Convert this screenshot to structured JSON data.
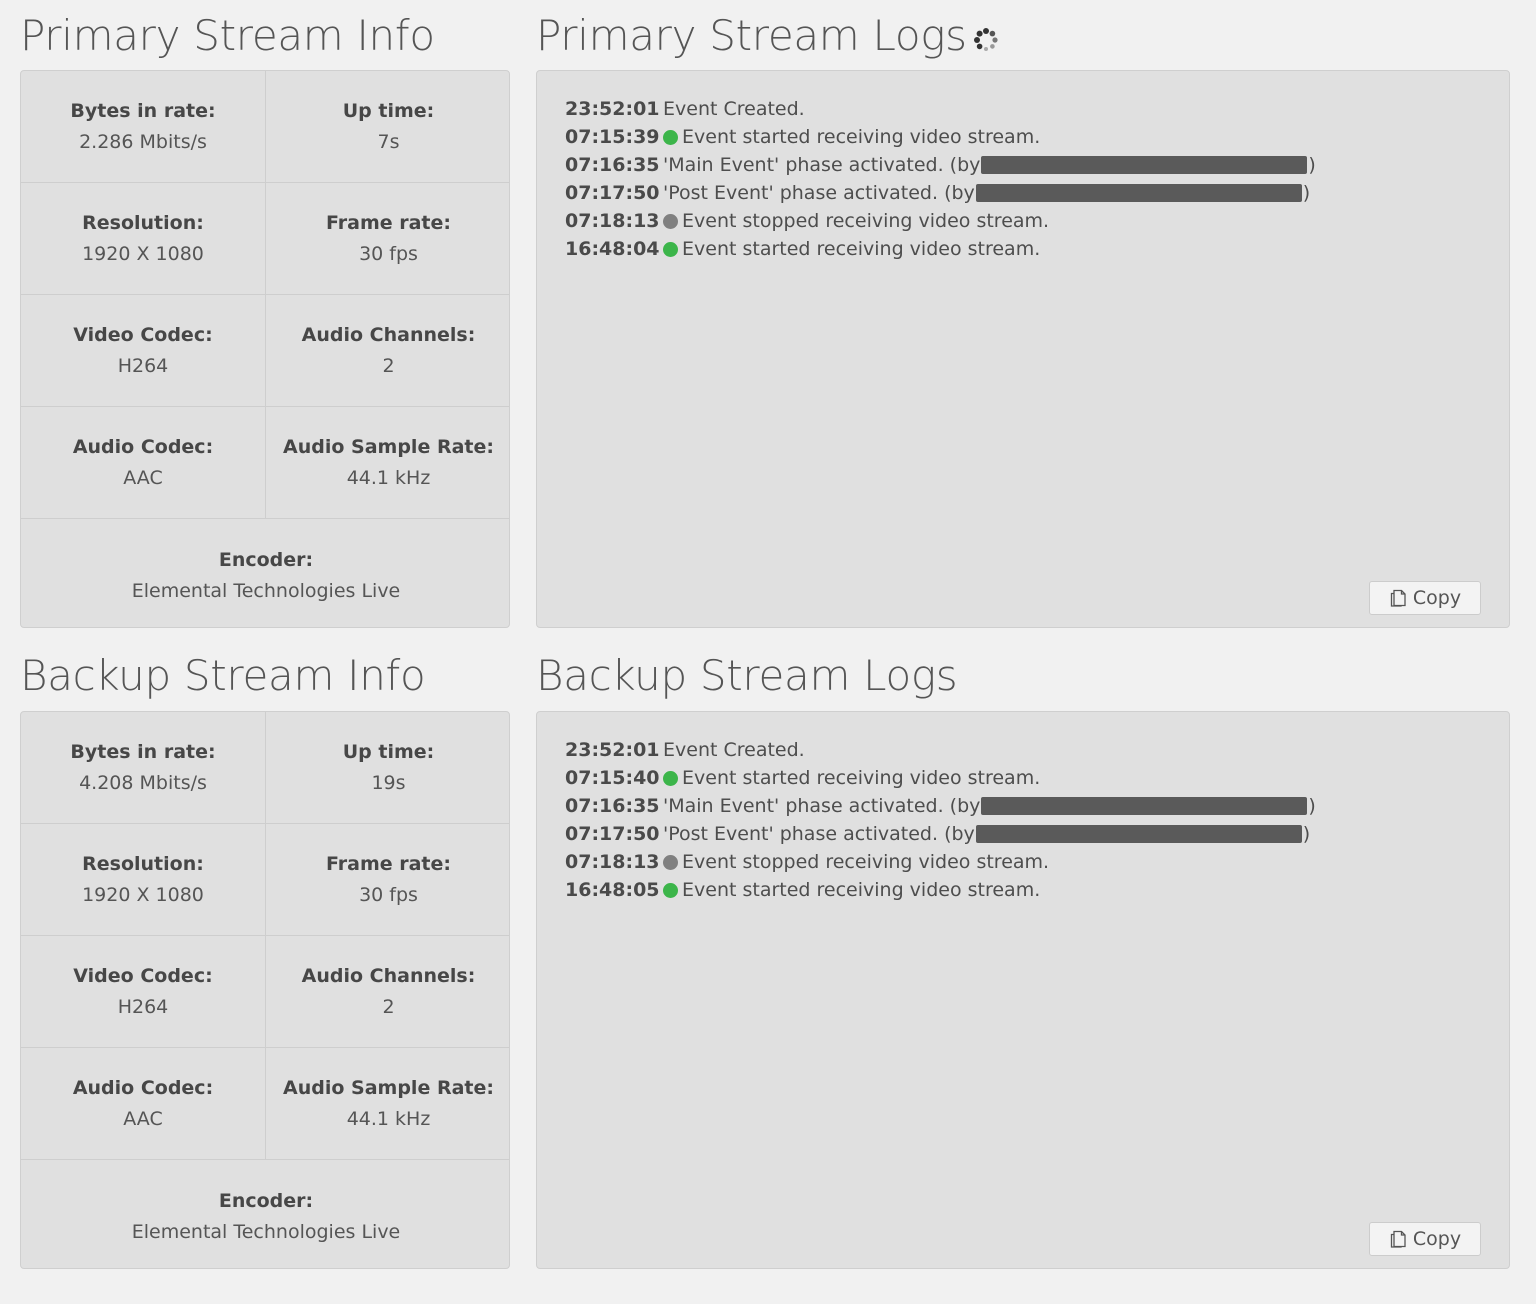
{
  "primary": {
    "info_title": "Primary Stream Info",
    "logs_title": "Primary Stream Logs",
    "info": {
      "bytes_in_rate": {
        "label": "Bytes in rate:",
        "value": "2.286 Mbits/s"
      },
      "up_time": {
        "label": "Up time:",
        "value": "7s"
      },
      "resolution": {
        "label": "Resolution:",
        "value": "1920 X 1080"
      },
      "frame_rate": {
        "label": "Frame rate:",
        "value": "30 fps"
      },
      "video_codec": {
        "label": "Video Codec:",
        "value": "H264"
      },
      "audio_channels": {
        "label": "Audio Channels:",
        "value": "2"
      },
      "audio_codec": {
        "label": "Audio Codec:",
        "value": "AAC"
      },
      "audio_sample_rate": {
        "label": "Audio Sample Rate:",
        "value": "44.1 kHz"
      },
      "encoder": {
        "label": "Encoder:",
        "value": "Elemental Technologies Live"
      }
    },
    "logs": [
      {
        "time": "23:52:01",
        "status": "none",
        "message": "Event Created."
      },
      {
        "time": "07:15:39",
        "status": "green",
        "message": "Event started receiving video stream."
      },
      {
        "time": "07:16:35",
        "status": "none",
        "message": "'Main Event' phase activated. (by",
        "redacted": true
      },
      {
        "time": "07:17:50",
        "status": "none",
        "message": "'Post Event' phase activated. (by",
        "redacted": true
      },
      {
        "time": "07:18:13",
        "status": "gray",
        "message": "Event stopped receiving video stream."
      },
      {
        "time": "16:48:04",
        "status": "green",
        "message": "Event started receiving video stream."
      }
    ],
    "copy_label": "Copy"
  },
  "backup": {
    "info_title": "Backup Stream Info",
    "logs_title": "Backup Stream Logs",
    "info": {
      "bytes_in_rate": {
        "label": "Bytes in rate:",
        "value": "4.208 Mbits/s"
      },
      "up_time": {
        "label": "Up time:",
        "value": "19s"
      },
      "resolution": {
        "label": "Resolution:",
        "value": "1920 X 1080"
      },
      "frame_rate": {
        "label": "Frame rate:",
        "value": "30 fps"
      },
      "video_codec": {
        "label": "Video Codec:",
        "value": "H264"
      },
      "audio_channels": {
        "label": "Audio Channels:",
        "value": "2"
      },
      "audio_codec": {
        "label": "Audio Codec:",
        "value": "AAC"
      },
      "audio_sample_rate": {
        "label": "Audio Sample Rate:",
        "value": "44.1 kHz"
      },
      "encoder": {
        "label": "Encoder:",
        "value": "Elemental Technologies Live"
      }
    },
    "logs": [
      {
        "time": "23:52:01",
        "status": "none",
        "message": "Event Created."
      },
      {
        "time": "07:15:40",
        "status": "green",
        "message": "Event started receiving video stream."
      },
      {
        "time": "07:16:35",
        "status": "none",
        "message": "'Main Event' phase activated. (by",
        "redacted": true
      },
      {
        "time": "07:17:50",
        "status": "none",
        "message": "'Post Event' phase activated. (by",
        "redacted": true
      },
      {
        "time": "07:18:13",
        "status": "gray",
        "message": "Event stopped receiving video stream."
      },
      {
        "time": "16:48:05",
        "status": "green",
        "message": "Event started receiving video stream."
      }
    ],
    "copy_label": "Copy"
  },
  "icons": {
    "loading": "spinner-icon",
    "copy": "copy-icon"
  },
  "colors": {
    "status_green": "#3cb54a",
    "status_gray": "#808080",
    "redaction": "#5a5a5a"
  }
}
